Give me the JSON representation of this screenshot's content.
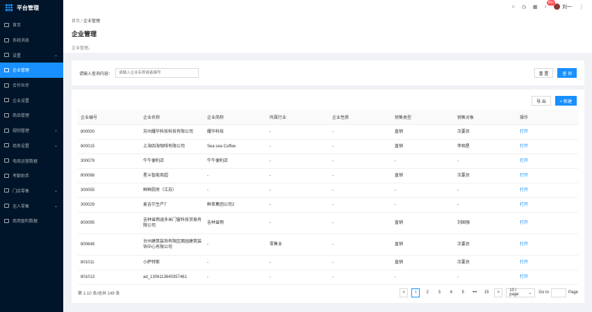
{
  "app": {
    "title": "平台管理"
  },
  "sidebar": {
    "items": [
      {
        "label": "首页",
        "icon": "home-icon",
        "arrow": ""
      },
      {
        "label": "系统消息",
        "icon": "message-icon",
        "arrow": ""
      },
      {
        "label": "设置",
        "icon": "settings-icon",
        "arrow": "⌄"
      },
      {
        "label": "企业管理",
        "icon": "company-icon",
        "arrow": "",
        "active": true
      },
      {
        "label": "合作伙伴",
        "icon": "partner-icon",
        "arrow": ""
      },
      {
        "label": "企业设置",
        "icon": "company-settings-icon",
        "arrow": ""
      },
      {
        "label": "商品管理",
        "icon": "goods-icon",
        "arrow": ""
      },
      {
        "label": "规则管理",
        "icon": "rules-icon",
        "arrow": "⌄"
      },
      {
        "label": "商务设置",
        "icon": "business-icon",
        "arrow": "⌄"
      },
      {
        "label": "电商运营数据",
        "icon": "ecommerce-icon",
        "arrow": ""
      },
      {
        "label": "考勤助手",
        "icon": "attendance-icon",
        "arrow": ""
      },
      {
        "label": "门店零售",
        "icon": "store-icon",
        "arrow": "⌄"
      },
      {
        "label": "无人零售",
        "icon": "unmanned-icon",
        "arrow": "⌄"
      },
      {
        "label": "商用盈利数据",
        "icon": "profit-icon",
        "arrow": ""
      }
    ]
  },
  "topbar": {
    "badge": "99+",
    "username": "刘一"
  },
  "pagehead": {
    "breadcrumb_home": "首页",
    "breadcrumb_sep": "/",
    "breadcrumb_current": "企业管理",
    "title": "企业管理",
    "desc": "企业管理。"
  },
  "search": {
    "label": "请输入查询内容：",
    "placeholder": "请输入企业名称或者编号",
    "reset_label": "重 置",
    "query_label": "查 询"
  },
  "table": {
    "export_label": "导 出",
    "new_label": "+ 新建",
    "columns": [
      "企业编号",
      "企业名称",
      "企业简称",
      "所属行业",
      "企业性质",
      "销售类型",
      "销售对象",
      "操作"
    ],
    "rows": [
      [
        "800000",
        "苏州耀华科技科技有限公司",
        "耀华科技",
        "-",
        "-",
        "直销",
        "次要员",
        "打开"
      ],
      [
        "800015",
        "上海四海咖啡有限公司",
        "Sea sea Coffee",
        "-",
        "-",
        "直销",
        "李相星",
        "打开"
      ],
      [
        "300079",
        "牛牛便利店",
        "牛牛便利店",
        "-",
        "-",
        "-",
        "-",
        "打开"
      ],
      [
        "800088",
        "星斗智能商超",
        "-",
        "-",
        "-",
        "直销",
        "次要员",
        "打开"
      ],
      [
        "300055",
        "鲜鲜厨房（江苏）",
        "-",
        "-",
        "-",
        "-",
        "-",
        "打开"
      ],
      [
        "300029",
        "麦吉尔生产7",
        "鲜草集团公司2",
        "-",
        "-",
        "-",
        "-",
        "打开"
      ],
      [
        "800095",
        "吉林省雨涵多米门窗科技贸易有限公司",
        "吉林省雨",
        "-",
        "-",
        "直销",
        "刘国强",
        "打开"
      ],
      [
        "800648",
        "台州建筑装饰有限区面园建筑装饰中心有限公司",
        "-",
        "零售业",
        "-",
        "直销",
        "次要员",
        "打开"
      ],
      [
        "801011",
        "小萨特斯",
        "-",
        "-",
        "-",
        "直销",
        "次要员",
        "打开"
      ],
      [
        "801013",
        "ad_1306113640357461",
        "-",
        "-",
        "-",
        "-",
        "-",
        "打开"
      ]
    ]
  },
  "pager": {
    "total": "第 1-10 条/总共 149 条",
    "prev": "<",
    "pages": [
      "1",
      "2",
      "3",
      "4",
      "5",
      "•••",
      "15"
    ],
    "next": ">",
    "size": "10 / page",
    "goto_label": "Go to",
    "page_label": "Page"
  }
}
